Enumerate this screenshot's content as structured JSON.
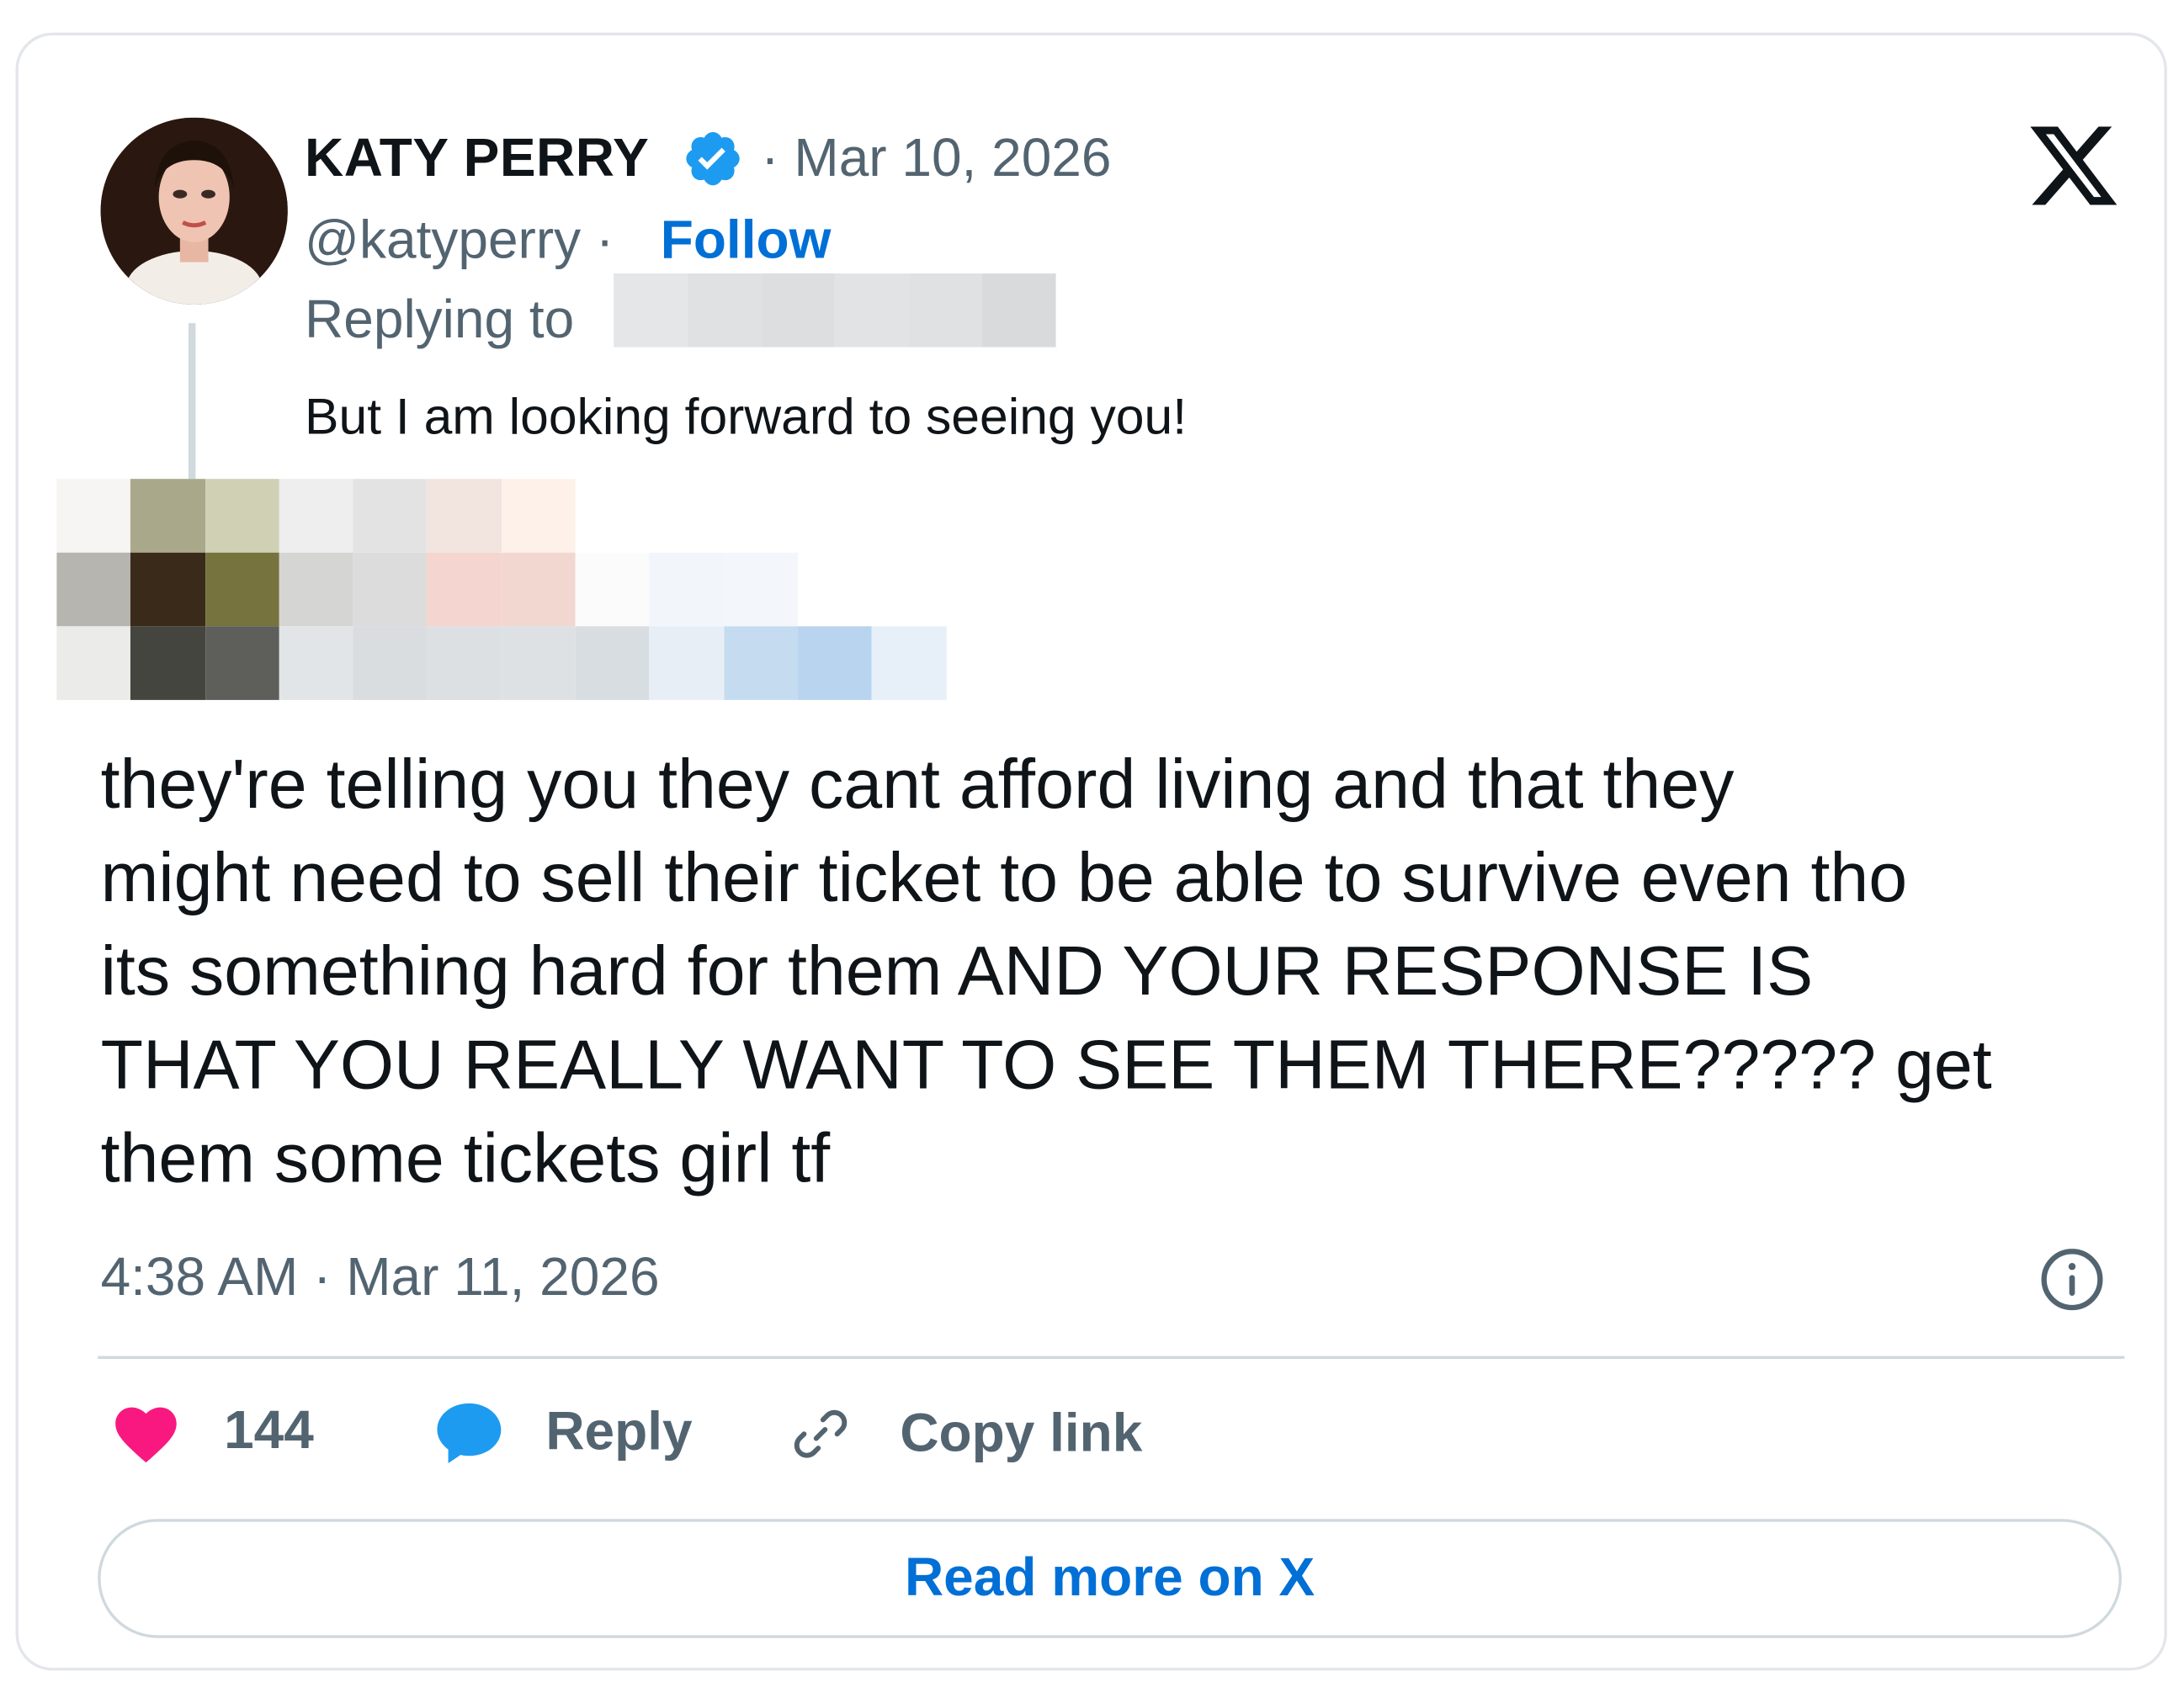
{
  "author": {
    "name": "KATY PERRY",
    "handle": "@katyperry",
    "separator_dot": "·",
    "follow_label": "Follow",
    "verified": true
  },
  "post_date_prefix": "· Mar 10, 2026",
  "reply": {
    "replying_to_label": "Replying to",
    "text": "But I am looking forward to seeing you!"
  },
  "quoted_text": "they're telling you they cant afford living and that they\nmight need to sell their ticket to be able to survive even tho\nits something hard for them AND YOUR RESPONSE IS\nTHAT YOU REALLY WANT TO SEE THEM THERE????? get\nthem some tickets girl tf",
  "timestamp": "4:38 AM · Mar 11, 2026",
  "actions": {
    "likes": "144",
    "reply_label": "Reply",
    "copy_link_label": "Copy link"
  },
  "read_more_label": "Read more on X",
  "icons": {
    "verified": "verified-badge-icon",
    "x_logo": "x-logo-icon",
    "info": "info-icon",
    "heart": "heart-icon",
    "reply": "speech-bubble-icon",
    "link": "link-icon"
  },
  "colors": {
    "accent": "#006fd6",
    "secondary_text": "#536471",
    "like": "#f91880",
    "reply_bubble": "#1d9bf0",
    "border": "#cfd9de"
  },
  "redaction_colors": {
    "handle": [
      "#e4e6e8",
      "#dfe1e3",
      "#dcdee0",
      "#e1e3e5",
      "#dfe1e3",
      "#d8dadc",
      "#e5e7e9"
    ],
    "avatar_grid": [
      "#f6f5f3",
      "#a9a88a",
      "#cfd0b4",
      "#eeeeee",
      "#e3e3e3",
      "#f2e4df",
      "#fdf1ea",
      "#ffffff",
      "#ffffff",
      "#ffffff",
      "#ffffff",
      "#ffffff",
      "#b7b5b0",
      "#3a2a1a",
      "#77733f",
      "#d5d5d3",
      "#dcdcdc",
      "#f4d5cf",
      "#f2d7d1",
      "#fbfbfc",
      "#f2f6fa",
      "#f3f6fa",
      "#ffffff",
      "#ffffff",
      "#ebebea",
      "#454540",
      "#5e5e5b",
      "#e2e5e7",
      "#d9dde0",
      "#dce0e3",
      "#dde1e4",
      "#d8dde1",
      "#e8eef5",
      "#c5dcf0",
      "#b8d4ee",
      "#e7f0f9"
    ]
  }
}
